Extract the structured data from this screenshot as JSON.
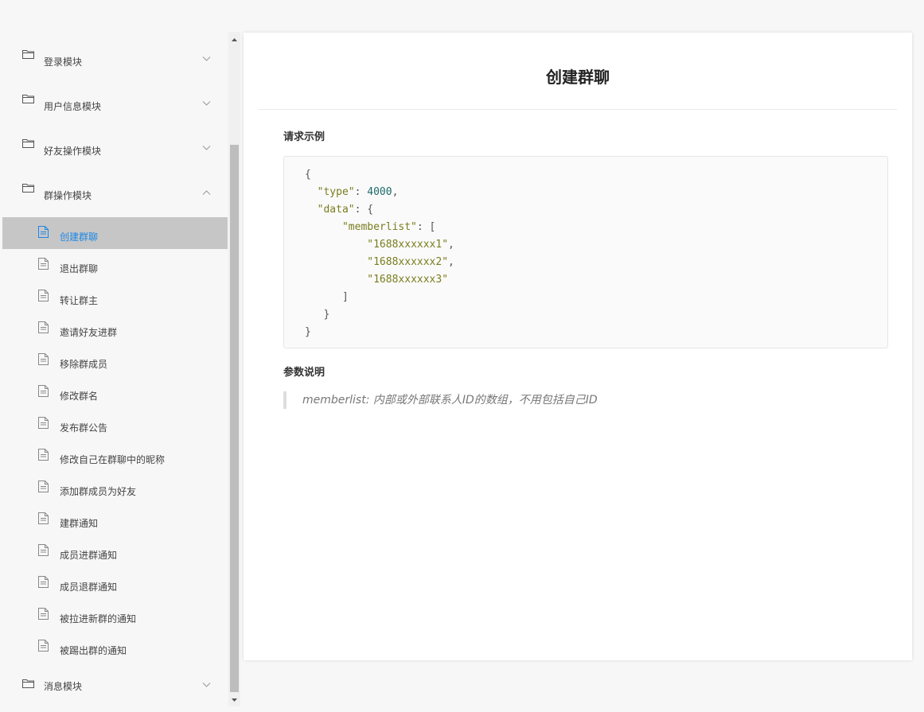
{
  "sidebar": {
    "modules_top": [
      {
        "label": "登录模块"
      },
      {
        "label": "用户信息模块"
      },
      {
        "label": "好友操作模块"
      },
      {
        "label": "群操作模块"
      }
    ],
    "group_items": [
      {
        "label": "创建群聊",
        "active": true
      },
      {
        "label": "退出群聊"
      },
      {
        "label": "转让群主"
      },
      {
        "label": "邀请好友进群"
      },
      {
        "label": "移除群成员"
      },
      {
        "label": "修改群名"
      },
      {
        "label": "发布群公告"
      },
      {
        "label": "修改自己在群聊中的昵称"
      },
      {
        "label": "添加群成员为好友"
      },
      {
        "label": "建群通知"
      },
      {
        "label": "成员进群通知"
      },
      {
        "label": "成员退群通知"
      },
      {
        "label": "被拉进新群的通知"
      },
      {
        "label": "被踢出群的通知"
      }
    ],
    "module_bottom": {
      "label": "消息模块"
    },
    "active_color": "#1e88e5"
  },
  "content": {
    "title": "创建群聊",
    "request_heading": "请求示例",
    "params_heading": "参数说明",
    "code": {
      "type_key": "\"type\"",
      "type_value": "4000",
      "data_key": "\"data\"",
      "memberlist_key": "\"memberlist\"",
      "members": [
        "\"1688xxxxxx1\"",
        "\"1688xxxxxx2\"",
        "\"1688xxxxxx3\""
      ]
    },
    "param_note": "memberlist: 内部或外部联系人ID的数组，不用包括自己ID"
  }
}
